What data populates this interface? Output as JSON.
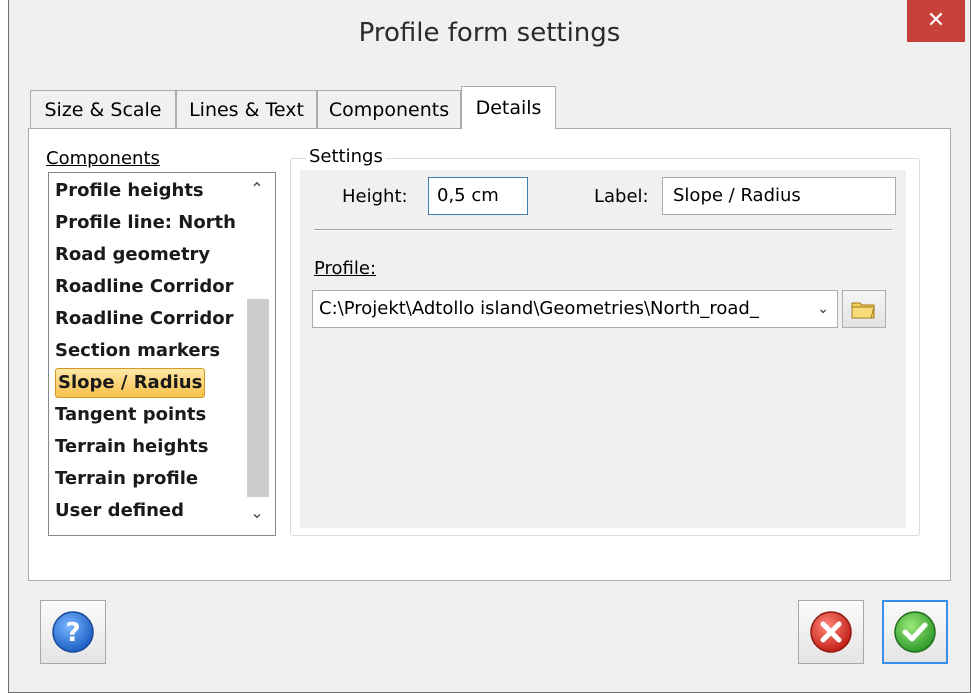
{
  "window": {
    "title": "Profile form settings",
    "close_label": "✕"
  },
  "tabs": [
    {
      "label": "Size & Scale",
      "active": false
    },
    {
      "label": "Lines & Text",
      "active": false
    },
    {
      "label": "Components",
      "active": false
    },
    {
      "label": "Details",
      "active": true
    }
  ],
  "components": {
    "label": "Components",
    "items": [
      "Profile heights",
      "Profile line: North",
      "Road geometry",
      "Roadline Corridor",
      "Roadline Corridor",
      "Section markers",
      "Slope / Radius",
      "Tangent points",
      "Terrain heights",
      "Terrain profile",
      "User defined"
    ],
    "selected": "Slope / Radius"
  },
  "settings": {
    "group_label": "Settings",
    "height_label": "Height:",
    "height_value": "0,5 cm",
    "label_label": "Label:",
    "label_value": "Slope / Radius",
    "profile_label": "Profile:",
    "profile_value": "C:\\Projekt\\Adtollo island\\Geometries\\North_road_"
  },
  "buttons": {
    "help": "help-icon",
    "cancel": "cancel-icon",
    "ok": "ok-icon"
  },
  "colors": {
    "close": "#c7403a",
    "selection": "#f7c04a",
    "focus": "#3a8ee6"
  }
}
